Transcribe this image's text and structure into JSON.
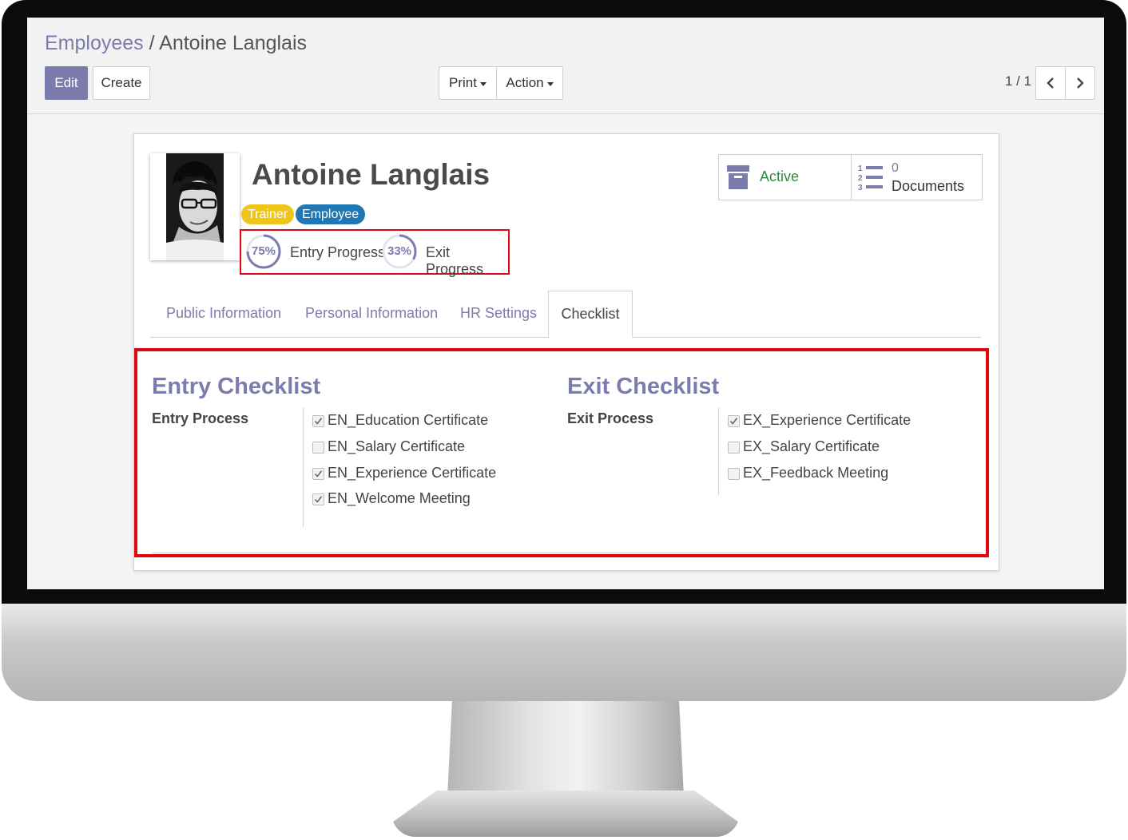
{
  "breadcrumb": {
    "parent": "Employees",
    "separator": "/",
    "current": "Antoine Langlais"
  },
  "buttons": {
    "edit": "Edit",
    "create": "Create",
    "print": "Print",
    "action": "Action"
  },
  "pager": {
    "value": "1 / 1"
  },
  "employee": {
    "name": "Antoine Langlais",
    "tags": [
      {
        "label": "Trainer",
        "color": "#f0c51a"
      },
      {
        "label": "Employee",
        "color": "#1f78b4"
      }
    ],
    "photo_icon": "person-photo"
  },
  "progress": {
    "entry": {
      "percent": 75,
      "percent_text": "75%",
      "label": "Entry Progress"
    },
    "exit": {
      "percent": 33,
      "percent_text": "33%",
      "label": "Exit Progress"
    }
  },
  "smart_buttons": {
    "active": {
      "label": "Active",
      "icon": "archive-icon"
    },
    "documents": {
      "count": "0",
      "label": "Documents",
      "icon": "numbered-list-icon"
    }
  },
  "tabs": [
    {
      "label": "Public Information",
      "active": false
    },
    {
      "label": "Personal Information",
      "active": false
    },
    {
      "label": "HR Settings",
      "active": false
    },
    {
      "label": "Checklist",
      "active": true
    }
  ],
  "entry_checklist": {
    "title": "Entry Checklist",
    "field_label": "Entry Process",
    "items": [
      {
        "label": "EN_Education Certificate",
        "checked": true
      },
      {
        "label": "EN_Salary Certificate",
        "checked": false
      },
      {
        "label": "EN_Experience Certificate",
        "checked": true
      },
      {
        "label": "EN_Welcome Meeting",
        "checked": true
      }
    ]
  },
  "exit_checklist": {
    "title": "Exit Checklist",
    "field_label": "Exit Process",
    "items": [
      {
        "label": "EX_Experience Certificate",
        "checked": true
      },
      {
        "label": "EX_Salary Certificate",
        "checked": false
      },
      {
        "label": "EX_Feedback Meeting",
        "checked": false
      }
    ]
  },
  "colors": {
    "accent": "#7c7bad",
    "highlight": "#e30613",
    "active_green": "#2e8b3e"
  }
}
